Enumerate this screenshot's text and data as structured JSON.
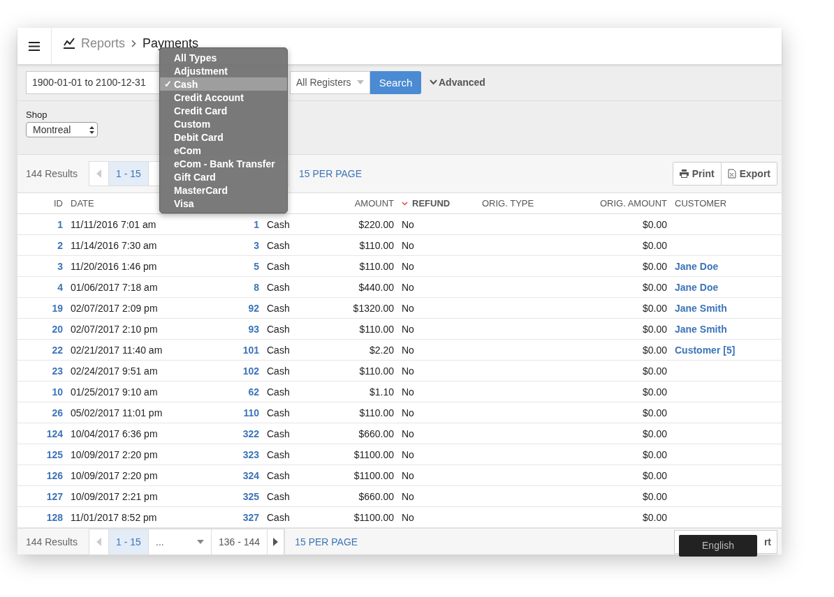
{
  "header": {
    "breadcrumb": [
      {
        "label": "Reports",
        "current": false
      },
      {
        "label": "Payments",
        "current": true
      }
    ]
  },
  "filters": {
    "date_range": "1900-01-01 to 2100-12-31",
    "register": "All Registers",
    "search_button": "Search",
    "advanced": "Advanced"
  },
  "type_menu": {
    "check": "✓",
    "items": [
      {
        "label": "All Types",
        "selected": false
      },
      {
        "label": "Adjustment",
        "selected": false
      },
      {
        "label": "Cash",
        "selected": true
      },
      {
        "label": "Credit Account",
        "selected": false
      },
      {
        "label": "Credit Card",
        "selected": false
      },
      {
        "label": "Custom",
        "selected": false
      },
      {
        "label": "Debit Card",
        "selected": false
      },
      {
        "label": "eCom",
        "selected": false
      },
      {
        "label": "eCom - Bank Transfer",
        "selected": false
      },
      {
        "label": "Gift Card",
        "selected": false
      },
      {
        "label": "MasterCard",
        "selected": false
      },
      {
        "label": "Visa",
        "selected": false
      }
    ]
  },
  "shop": {
    "label": "Shop",
    "value": "Montreal"
  },
  "top_pager": {
    "results": "144 Results",
    "pages": [
      {
        "label": "1 - 15",
        "selected": true
      }
    ],
    "per_page": "15 PER PAGE",
    "buttons": [
      {
        "kind": "print",
        "label": "Print"
      },
      {
        "kind": "export",
        "label": "Export"
      }
    ]
  },
  "table": {
    "headers": {
      "id": {
        "label": "ID"
      },
      "date": {
        "label": "DATE"
      },
      "amount": {
        "label": "AMOUNT"
      },
      "refund": {
        "label": "REFUND",
        "sorted": true
      },
      "orig_type": {
        "label": "ORIG. TYPE"
      },
      "orig_amount": {
        "label": "ORIG. AMOUNT"
      },
      "customer": {
        "label": "CUSTOMER"
      }
    },
    "rows": [
      {
        "id": "1",
        "date": "11/11/2016 7:01 am",
        "column_3": "1",
        "column_4": "Cash",
        "amount": "$220.00",
        "refund": "No",
        "orig_amount": "$0.00"
      },
      {
        "id": "2",
        "date": "11/14/2016 7:30 am",
        "column_3": "3",
        "column_4": "Cash",
        "amount": "$110.00",
        "refund": "No",
        "orig_amount": "$0.00"
      },
      {
        "id": "3",
        "date": "11/20/2016 1:46 pm",
        "column_3": "5",
        "column_4": "Cash",
        "amount": "$110.00",
        "refund": "No",
        "orig_amount": "$0.00",
        "customer": "Jane Doe"
      },
      {
        "id": "4",
        "date": "01/06/2017 7:18 am",
        "column_3": "8",
        "column_4": "Cash",
        "amount": "$440.00",
        "refund": "No",
        "orig_amount": "$0.00",
        "customer": "Jane Doe"
      },
      {
        "id": "19",
        "date": "02/07/2017 2:09 pm",
        "column_3": "92",
        "column_4": "Cash",
        "amount": "$1320.00",
        "refund": "No",
        "orig_amount": "$0.00",
        "customer": "Jane Smith"
      },
      {
        "id": "20",
        "date": "02/07/2017 2:10 pm",
        "column_3": "93",
        "column_4": "Cash",
        "amount": "$110.00",
        "refund": "No",
        "orig_amount": "$0.00",
        "customer": "Jane Smith"
      },
      {
        "id": "22",
        "date": "02/21/2017 11:40 am",
        "column_3": "101",
        "column_4": "Cash",
        "amount": "$2.20",
        "refund": "No",
        "orig_amount": "$0.00",
        "customer": "Customer [5]"
      },
      {
        "id": "23",
        "date": "02/24/2017 9:51 am",
        "column_3": "102",
        "column_4": "Cash",
        "amount": "$110.00",
        "refund": "No",
        "orig_amount": "$0.00"
      },
      {
        "id": "10",
        "date": "01/25/2017 9:10 am",
        "column_3": "62",
        "column_4": "Cash",
        "amount": "$1.10",
        "refund": "No",
        "orig_amount": "$0.00"
      },
      {
        "id": "26",
        "date": "05/02/2017 11:01 pm",
        "column_3": "110",
        "column_4": "Cash",
        "amount": "$110.00",
        "refund": "No",
        "orig_amount": "$0.00"
      },
      {
        "id": "124",
        "date": "10/04/2017 6:36 pm",
        "column_3": "322",
        "column_4": "Cash",
        "amount": "$660.00",
        "refund": "No",
        "orig_amount": "$0.00"
      },
      {
        "id": "125",
        "date": "10/09/2017 2:20 pm",
        "column_3": "323",
        "column_4": "Cash",
        "amount": "$1100.00",
        "refund": "No",
        "orig_amount": "$0.00"
      },
      {
        "id": "126",
        "date": "10/09/2017 2:20 pm",
        "column_3": "324",
        "column_4": "Cash",
        "amount": "$1100.00",
        "refund": "No",
        "orig_amount": "$0.00"
      },
      {
        "id": "127",
        "date": "10/09/2017 2:21 pm",
        "column_3": "325",
        "column_4": "Cash",
        "amount": "$660.00",
        "refund": "No",
        "orig_amount": "$0.00"
      },
      {
        "id": "128",
        "date": "11/01/2017 8:52 pm",
        "column_3": "327",
        "column_4": "Cash",
        "amount": "$1100.00",
        "refund": "No",
        "orig_amount": "$0.00"
      }
    ]
  },
  "bottom_pager": {
    "results": "144 Results",
    "pages": [
      {
        "label": "1 - 15",
        "selected": true
      },
      {
        "label": "...",
        "kind": "select"
      },
      {
        "label": "136 - 144",
        "selected": false
      }
    ],
    "per_page": "15 PER PAGE",
    "button_fragment": "rt"
  },
  "language_tooltip": "English"
}
